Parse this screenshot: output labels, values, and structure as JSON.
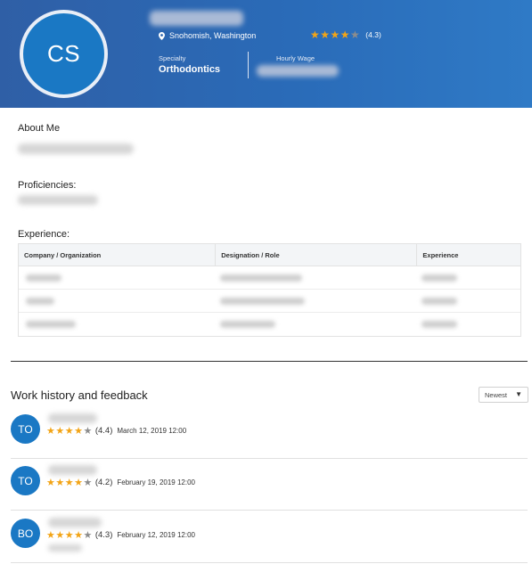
{
  "profile": {
    "initials": "CS",
    "location": "Snohomish, Washington",
    "rating_stars": "★★★★",
    "rating_half": "★",
    "rating_value": "(4.3)",
    "specialty_label": "Specialty",
    "specialty_value": "Orthodontics",
    "wage_label": "Hourly Wage"
  },
  "sections": {
    "about": "About Me",
    "proficiencies": "Proficiencies:",
    "experience": "Experience:"
  },
  "experience_table": {
    "headers": [
      "Company / Organization",
      "Designation / Role",
      "Experience"
    ]
  },
  "work_history": {
    "title": "Work history and feedback",
    "sort_value": "Newest",
    "sort_caret": "▼",
    "items": [
      {
        "initials": "TO",
        "stars": "★★★★",
        "half": "★",
        "rating": "(4.4)",
        "date": "March 12, 2019 12:00"
      },
      {
        "initials": "TO",
        "stars": "★★★★",
        "half": "★",
        "rating": "(4.2)",
        "date": "February 19, 2019 12:00"
      },
      {
        "initials": "BO",
        "stars": "★★★★",
        "half": "★",
        "rating": "(4.3)",
        "date": "February 12, 2019 12:00"
      }
    ]
  },
  "colors": {
    "header_bg": "#2f6ab4",
    "accent": "#1a78c4",
    "star": "#f2a416"
  }
}
